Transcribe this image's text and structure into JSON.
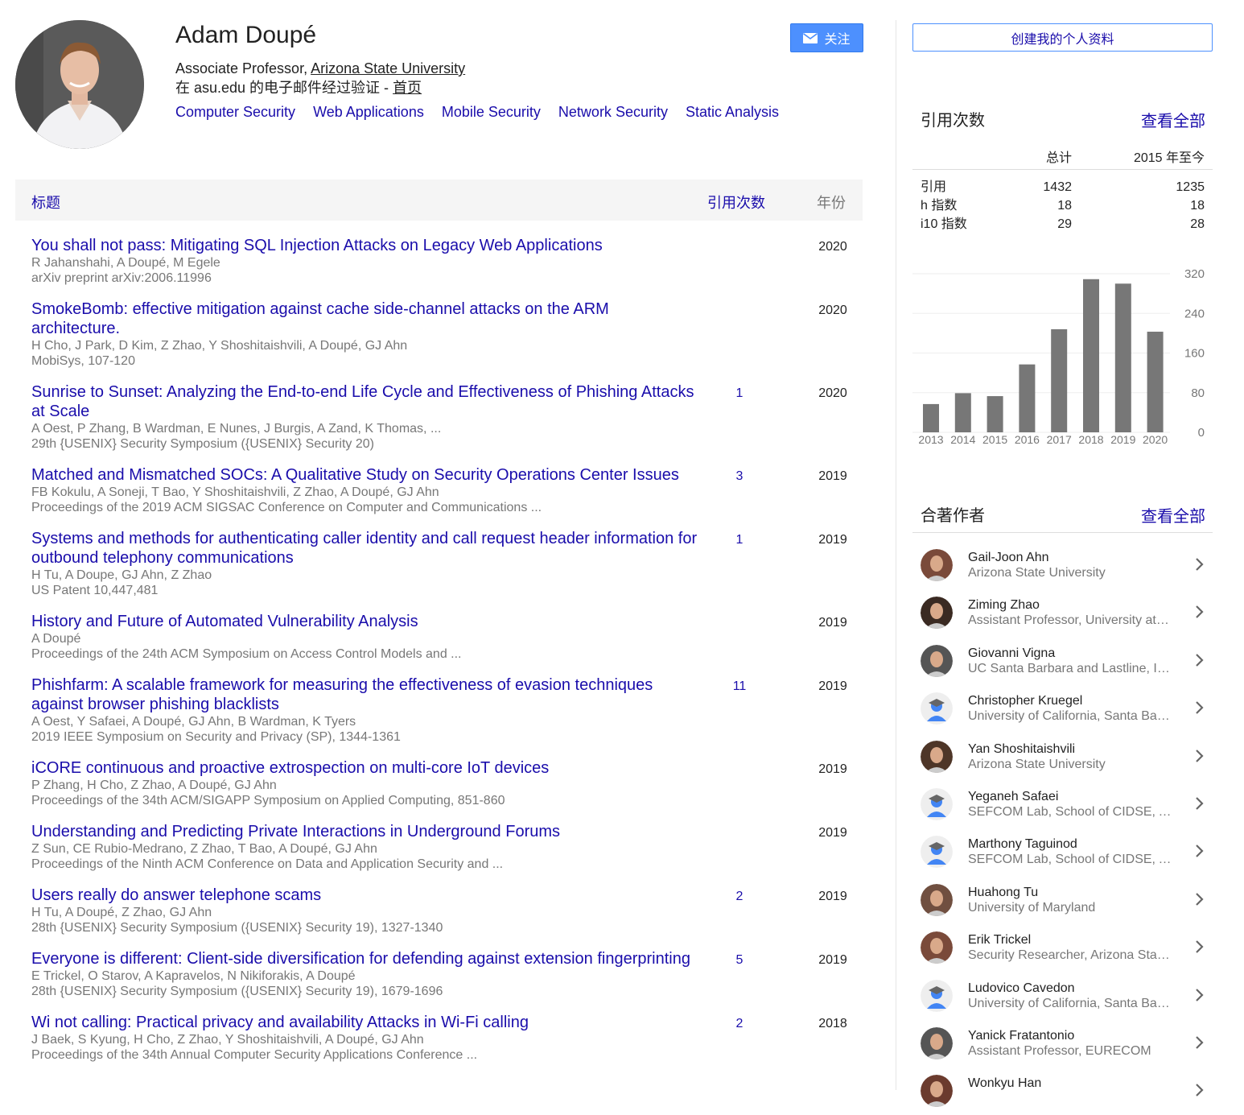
{
  "profile": {
    "name": "Adam Doupé",
    "affiliation_prefix": "Associate Professor, ",
    "affiliation_link": "Arizona State University",
    "email_text": "在 asu.edu 的电子邮件经过验证 - ",
    "homepage_link": "首页",
    "interests": [
      "Computer Security",
      "Web Applications",
      "Mobile Security",
      "Network Security",
      "Static Analysis"
    ],
    "follow_label": "关注"
  },
  "table": {
    "col_title": "标题",
    "col_cites": "引用次数",
    "col_year": "年份",
    "rows": [
      {
        "title": "You shall not pass: Mitigating SQL Injection Attacks on Legacy Web Applications",
        "authors": "R Jahanshahi, A Doupé, M Egele",
        "venue": "arXiv preprint arXiv:2006.11996",
        "cites": "",
        "year": "2020"
      },
      {
        "title": "SmokeBomb: effective mitigation against cache side-channel attacks on the ARM architecture.",
        "authors": "H Cho, J Park, D Kim, Z Zhao, Y Shoshitaishvili, A Doupé, GJ Ahn",
        "venue": "MobiSys, 107-120",
        "cites": "",
        "year": "2020"
      },
      {
        "title": "Sunrise to Sunset: Analyzing the End-to-end Life Cycle and Effectiveness of Phishing Attacks at Scale",
        "authors": "A Oest, P Zhang, B Wardman, E Nunes, J Burgis, A Zand, K Thomas, ...",
        "venue": "29th {USENIX} Security Symposium ({USENIX} Security 20)",
        "cites": "1",
        "year": "2020"
      },
      {
        "title": "Matched and Mismatched SOCs: A Qualitative Study on Security Operations Center Issues",
        "authors": "FB Kokulu, A Soneji, T Bao, Y Shoshitaishvili, Z Zhao, A Doupé, GJ Ahn",
        "venue": "Proceedings of the 2019 ACM SIGSAC Conference on Computer and Communications ...",
        "cites": "3",
        "year": "2019"
      },
      {
        "title": "Systems and methods for authenticating caller identity and call request header information for outbound telephony communications",
        "authors": "H Tu, A Doupe, GJ Ahn, Z Zhao",
        "venue": "US Patent 10,447,481",
        "cites": "1",
        "year": "2019"
      },
      {
        "title": "History and Future of Automated Vulnerability Analysis",
        "authors": "A Doupé",
        "venue": "Proceedings of the 24th ACM Symposium on Access Control Models and ...",
        "cites": "",
        "year": "2019"
      },
      {
        "title": "Phishfarm: A scalable framework for measuring the effectiveness of evasion techniques against browser phishing blacklists",
        "authors": "A Oest, Y Safaei, A Doupé, GJ Ahn, B Wardman, K Tyers",
        "venue": "2019 IEEE Symposium on Security and Privacy (SP), 1344-1361",
        "cites": "11",
        "year": "2019"
      },
      {
        "title": "iCORE continuous and proactive extrospection on multi-core IoT devices",
        "authors": "P Zhang, H Cho, Z Zhao, A Doupé, GJ Ahn",
        "venue": "Proceedings of the 34th ACM/SIGAPP Symposium on Applied Computing, 851-860",
        "cites": "",
        "year": "2019"
      },
      {
        "title": "Understanding and Predicting Private Interactions in Underground Forums",
        "authors": "Z Sun, CE Rubio-Medrano, Z Zhao, T Bao, A Doupé, GJ Ahn",
        "venue": "Proceedings of the Ninth ACM Conference on Data and Application Security and ...",
        "cites": "",
        "year": "2019"
      },
      {
        "title": "Users really do answer telephone scams",
        "authors": "H Tu, A Doupé, Z Zhao, GJ Ahn",
        "venue": "28th {USENIX} Security Symposium ({USENIX} Security 19), 1327-1340",
        "cites": "2",
        "year": "2019"
      },
      {
        "title": "Everyone is different: Client-side diversification for defending against extension fingerprinting",
        "authors": "E Trickel, O Starov, A Kapravelos, N Nikiforakis, A Doupé",
        "venue": "28th {USENIX} Security Symposium ({USENIX} Security 19), 1679-1696",
        "cites": "5",
        "year": "2019"
      },
      {
        "title": "Wi not calling: Practical privacy and availability Attacks in Wi-Fi calling",
        "authors": "J Baek, S Kyung, H Cho, Z Zhao, Y Shoshitaishvili, A Doupé, GJ Ahn",
        "venue": "Proceedings of the 34th Annual Computer Security Applications Conference ...",
        "cites": "2",
        "year": "2018"
      }
    ]
  },
  "sidebar": {
    "create_profile_label": "创建我的个人资料",
    "citations_title": "引用次数",
    "see_all_label": "查看全部",
    "col_total": "总计",
    "col_since": "2015 年至今",
    "stats": [
      {
        "label": "引用",
        "total": "1432",
        "since": "1235"
      },
      {
        "label": "h 指数",
        "total": "18",
        "since": "18"
      },
      {
        "label": "i10 指数",
        "total": "29",
        "since": "28"
      }
    ],
    "coauthors_title": "合著作者",
    "coauthors": [
      {
        "name": "Gail-Joon Ahn",
        "affiliation": "Arizona State University",
        "avatar": "photo"
      },
      {
        "name": "Ziming Zhao",
        "affiliation": "Assistant Professor, University at Buffalo",
        "avatar": "photo"
      },
      {
        "name": "Giovanni Vigna",
        "affiliation": "UC Santa Barbara and Lastline, Inc.",
        "avatar": "photo"
      },
      {
        "name": "Christopher Kruegel",
        "affiliation": "University of California, Santa Barbara",
        "avatar": "placeholder"
      },
      {
        "name": "Yan Shoshitaishvili",
        "affiliation": "Arizona State University",
        "avatar": "photo"
      },
      {
        "name": "Yeganeh Safaei",
        "affiliation": "SEFCOM Lab, School of CIDSE, Arizona State University",
        "avatar": "placeholder"
      },
      {
        "name": "Marthony Taguinod",
        "affiliation": "SEFCOM Lab, School of CIDSE, Arizona State University",
        "avatar": "placeholder"
      },
      {
        "name": "Huahong Tu",
        "affiliation": "University of Maryland",
        "avatar": "photo"
      },
      {
        "name": "Erik Trickel",
        "affiliation": "Security Researcher, Arizona State University",
        "avatar": "photo"
      },
      {
        "name": "Ludovico Cavedon",
        "affiliation": "University of California, Santa Barbara",
        "avatar": "placeholder"
      },
      {
        "name": "Yanick Fratantonio",
        "affiliation": "Assistant Professor, EURECOM",
        "avatar": "photo"
      },
      {
        "name": "Wonkyu Han",
        "affiliation": "",
        "avatar": "photo"
      }
    ]
  },
  "chart_data": {
    "type": "bar",
    "categories": [
      "2013",
      "2014",
      "2015",
      "2016",
      "2017",
      "2018",
      "2019",
      "2020"
    ],
    "values": [
      57,
      79,
      73,
      137,
      208,
      309,
      300,
      203
    ],
    "ylim": [
      0,
      320
    ],
    "yticks": [
      "0",
      "80",
      "160",
      "240",
      "320"
    ],
    "bar_color": "#777777",
    "grid": true
  },
  "colors": {
    "link": "#1a0dab",
    "accent": "#4d90fe",
    "muted": "#777777"
  }
}
